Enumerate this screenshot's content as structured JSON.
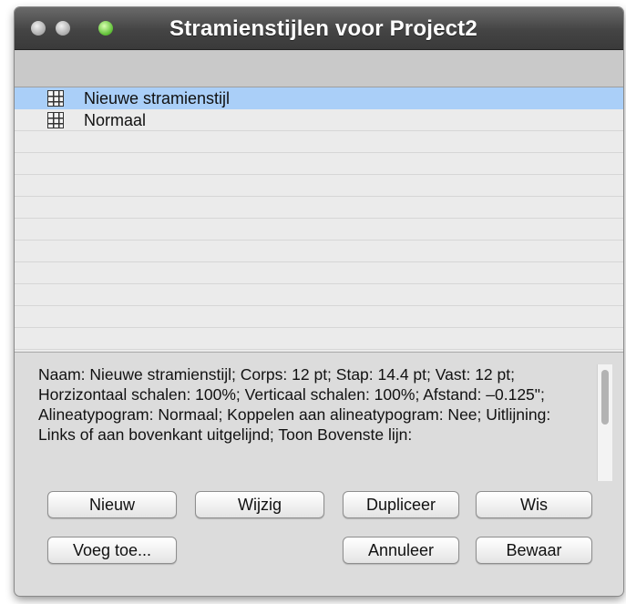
{
  "window": {
    "title": "Stramienstijlen voor Project2"
  },
  "list": {
    "items": [
      {
        "label": "Nieuwe stramienstijl",
        "selected": true,
        "icon": "grid-icon"
      },
      {
        "label": "Normaal",
        "selected": false,
        "icon": "grid-icon"
      }
    ]
  },
  "description": {
    "text": "Naam: Nieuwe stramienstijl; Corps: 12 pt; Stap: 14.4 pt; Vast: 12 pt; Horzizontaal schalen: 100%; Verticaal schalen: 100%; Afstand: –0.125\"; Alineatypogram: Normaal; Koppelen aan alineatypogram: Nee; Uitlijning: Links of aan bovenkant uitgelijnd; Toon Bovenste lijn:"
  },
  "buttons": {
    "nieuw": "Nieuw",
    "wijzig": "Wijzig",
    "dupliceer": "Dupliceer",
    "wis": "Wis",
    "voeg_toe": "Voeg toe...",
    "annuleer": "Annuleer",
    "bewaar": "Bewaar"
  },
  "colors": {
    "selection": "#aacff8",
    "titlebar": "#444444",
    "zoom_button": "#63c23a"
  }
}
